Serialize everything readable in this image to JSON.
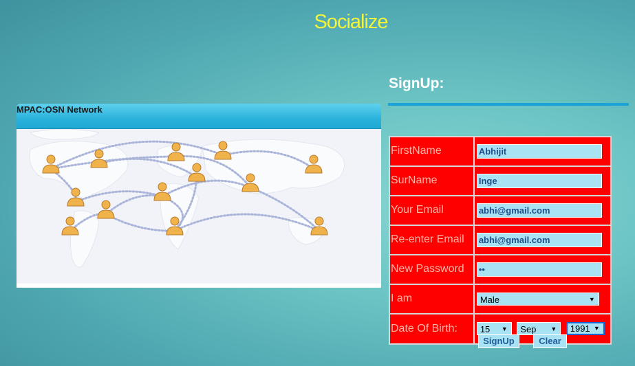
{
  "site_title": "Socialize",
  "network_panel": {
    "title": "MPAC:OSN Network"
  },
  "signup": {
    "heading": "SignUp:",
    "fields": {
      "firstname": {
        "label": "FirstName",
        "value": "Abhijit"
      },
      "surname": {
        "label": "SurName",
        "value": "Inge"
      },
      "email": {
        "label": "Your Email",
        "value": "abhi@gmail.com"
      },
      "reemail": {
        "label": "Re-enter Email",
        "value": "abhi@gmail.com"
      },
      "password": {
        "label": "New Password",
        "value": "••"
      },
      "gender": {
        "label": "I am",
        "selected": "Male"
      },
      "dob": {
        "label": "Date Of Birth:",
        "day": "15",
        "month": "Sep",
        "year": "1991"
      }
    },
    "buttons": {
      "signup_label": "SignUp",
      "clear_label": "Clear"
    }
  },
  "colors": {
    "title": "#f2f53c",
    "form_background": "#ff0000",
    "input_background": "#a8e2f3",
    "header_bar": "#1aa3d6"
  }
}
